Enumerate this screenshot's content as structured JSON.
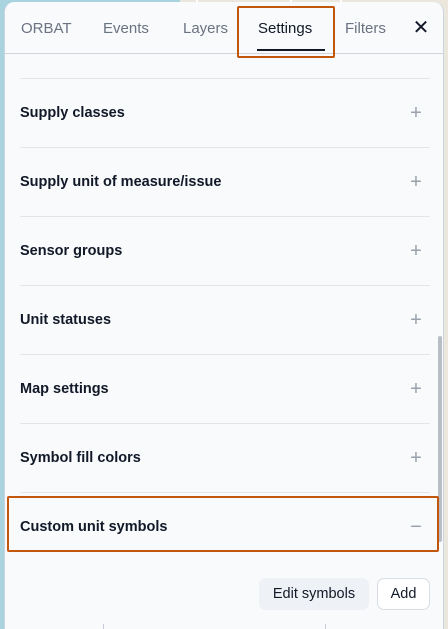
{
  "tabs": [
    {
      "label": "ORBAT",
      "active": false
    },
    {
      "label": "Events",
      "active": false
    },
    {
      "label": "Layers",
      "active": false
    },
    {
      "label": "Settings",
      "active": true
    },
    {
      "label": "Filters",
      "active": false
    }
  ],
  "close_label": "✕",
  "sections": [
    {
      "title": "Supply classes",
      "toggle": "+",
      "expanded": false
    },
    {
      "title": "Supply unit of measure/issue",
      "toggle": "+",
      "expanded": false
    },
    {
      "title": "Sensor groups",
      "toggle": "+",
      "expanded": false
    },
    {
      "title": "Unit statuses",
      "toggle": "+",
      "expanded": false
    },
    {
      "title": "Map settings",
      "toggle": "+",
      "expanded": false
    },
    {
      "title": "Symbol fill colors",
      "toggle": "+",
      "expanded": false
    },
    {
      "title": "Custom unit symbols",
      "toggle": "−",
      "expanded": true
    }
  ],
  "actions": {
    "edit_symbols_label": "Edit symbols",
    "add_label": "Add"
  },
  "colors": {
    "highlight": "#c2560c",
    "panel_bg": "#f8fafc",
    "map_water": "#a9d3df"
  }
}
